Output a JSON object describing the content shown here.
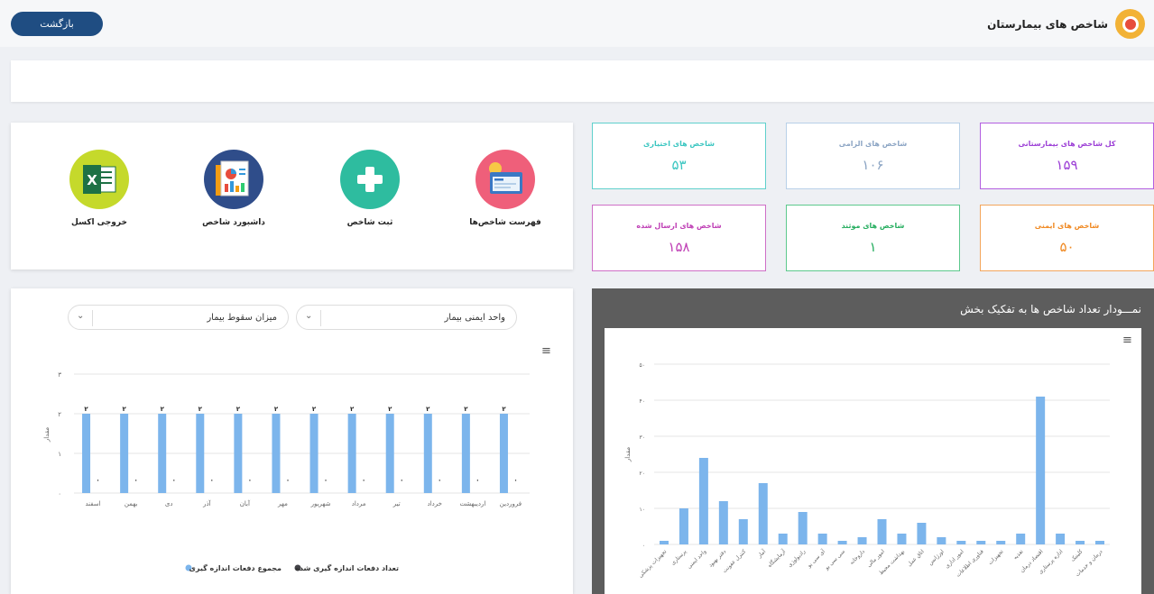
{
  "header": {
    "title": "شاخص های بیمارستان",
    "back_label": "بازگشت"
  },
  "actions": [
    {
      "label": "فهرست شاخص‌ها"
    },
    {
      "label": "ثبت شاخص"
    },
    {
      "label": "داشبورد شاخص"
    },
    {
      "label": "خروجی اکسل"
    }
  ],
  "cards": [
    {
      "title": "کل شاخص های بیمارستانی",
      "value": "۱۵۹",
      "color": "#9c3fd6"
    },
    {
      "title": "شاخص های الزامی",
      "value": "۱۰۶",
      "color": "#8ca5c4"
    },
    {
      "title": "شاخص های اختیاری",
      "value": "۵۳",
      "color": "#3bc6c1"
    },
    {
      "title": "شاخص های ایمنی",
      "value": "۵۰",
      "color": "#f08a24"
    },
    {
      "title": "شاخص های موثند",
      "value": "۱",
      "color": "#27ae60"
    },
    {
      "title": "شاخص های ارسال شده",
      "value": "۱۵۸",
      "color": "#bf3fb5"
    }
  ],
  "filters": {
    "unit_value": "واحد ایمنی بیمار",
    "index_value": "میزان سقوط بیمار"
  },
  "charts": [
    {
      "type": "bar",
      "ylabel": "مقدار",
      "ylim": [
        0,
        3
      ],
      "yticks": [
        "۰",
        "۱",
        "۲",
        "۳"
      ],
      "categories": [
        "فروردین",
        "اردیبهشت",
        "خرداد",
        "تیر",
        "مرداد",
        "شهریور",
        "مهر",
        "آبان",
        "آذر",
        "دی",
        "بهمن",
        "اسفند"
      ],
      "series": [
        {
          "name": "مجموع دفعات اندازه گیری",
          "color": "#7cb5ec",
          "values": [
            2,
            2,
            2,
            2,
            2,
            2,
            2,
            2,
            2,
            2,
            2,
            2
          ],
          "data_labels": [
            "۲",
            "۲",
            "۲",
            "۲",
            "۲",
            "۲",
            "۲",
            "۲",
            "۲",
            "۲",
            "۲",
            "۲"
          ]
        },
        {
          "name": "تعداد دفعات اندازه گیری شده",
          "color": "#434348",
          "values": [
            0,
            0,
            0,
            0,
            0,
            0,
            0,
            0,
            0,
            0,
            0,
            0
          ],
          "data_labels": [
            "۰",
            "۰",
            "۰",
            "۰",
            "۰",
            "۰",
            "۰",
            "۰",
            "۰",
            "۰",
            "۰",
            "۰"
          ]
        }
      ]
    },
    {
      "type": "bar",
      "title": "نمـــودار تعداد شاخص ها به تفکیک بخش",
      "ylabel": "مقدار",
      "ylim": [
        0,
        50
      ],
      "yticks": [
        "۰",
        "۱۰",
        "۲۰",
        "۳۰",
        "۴۰",
        "۵۰"
      ],
      "categories": [
        "تجهیزات پزشکی",
        "پرستاری",
        "واحد ایمنی",
        "دفتر بهبود",
        "کنترل عفونت",
        "آمار",
        "آزمایشگاه",
        "رادیولوژی",
        "آی سی یو",
        "سی سی یو",
        "داروخانه",
        "امور مالی",
        "بهداشت محیط",
        "اتاق عمل",
        "اورژانس",
        "امور اداری",
        "فناوری اطلاعات",
        "تجهیزات",
        "تغذیه",
        "اقتصاد درمان",
        "اداره پرستاری",
        "کلینیک",
        "درمان و خدمات"
      ],
      "values": [
        1,
        10,
        24,
        12,
        7,
        17,
        3,
        9,
        3,
        1,
        2,
        7,
        3,
        6,
        2,
        1,
        1,
        1,
        3,
        41,
        3,
        1,
        1
      ],
      "color": "#7cb5ec"
    }
  ]
}
